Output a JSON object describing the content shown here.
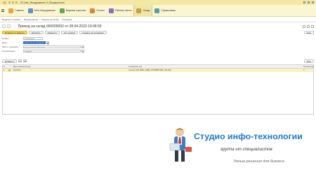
{
  "titlebar": {
    "logo": "1С",
    "title": "ИТ-Инв: Оборудование  1.0 (Предприятие)"
  },
  "nav": {
    "items": [
      {
        "label": "Главное",
        "color": "#e9a73b"
      },
      {
        "label": "Мое оборудование",
        "color": "#5b8fd6"
      },
      {
        "label": "Ведение карточек",
        "color": "#6aa84f"
      },
      {
        "label": "Отчеты",
        "color": "#e0852f"
      },
      {
        "label": "Рабочие места",
        "color": "#8a6fc7"
      },
      {
        "label": "Склад",
        "color": "#c9a235"
      },
      {
        "label": "Справочники",
        "color": "#4aa3a5"
      }
    ]
  },
  "subnav": {
    "items": [
      "Ведение остатков",
      "Перемещение",
      "Приход на склад",
      "Списание"
    ]
  },
  "document": {
    "title": "Приход на склад 000000002 от 28.04.2023 10:06:50",
    "toolbar": {
      "post_close": "Провести и закрыть",
      "save": "Записать",
      "post": "Провести",
      "act": "Акт приема",
      "create_basis": "Создать на основании",
      "more": "Еще"
    },
    "fields": {
      "number_label": "Номер:",
      "number_value": "000000002",
      "date_label": "Дата:",
      "date_value": "28.04.2023 10:06:50",
      "place_label": "Место хранения:",
      "place_value": "Неодержанный склад",
      "org_label": "Организация:",
      "org_value": "ЛЕММА"
    }
  },
  "table": {
    "toolbar": {
      "add": "Добавить",
      "up": "▲",
      "down": "▼",
      "more": "Еще"
    },
    "columns": [
      "N",
      "",
      "Вид номенклатуры",
      "Номенклатура",
      "Количество"
    ],
    "rows": [
      {
        "n": "1",
        "kind": "Ноутбук",
        "item": "Lenovo V15 G001, AMD, 15Г/Ф/ВГ/256, Ноутбук",
        "qty": "1"
      }
    ]
  },
  "promo": {
    "title": "Студио инфо-технологии",
    "subtitle": "группа ит специалистов",
    "tagline": "Умные решения для бизнеса"
  }
}
